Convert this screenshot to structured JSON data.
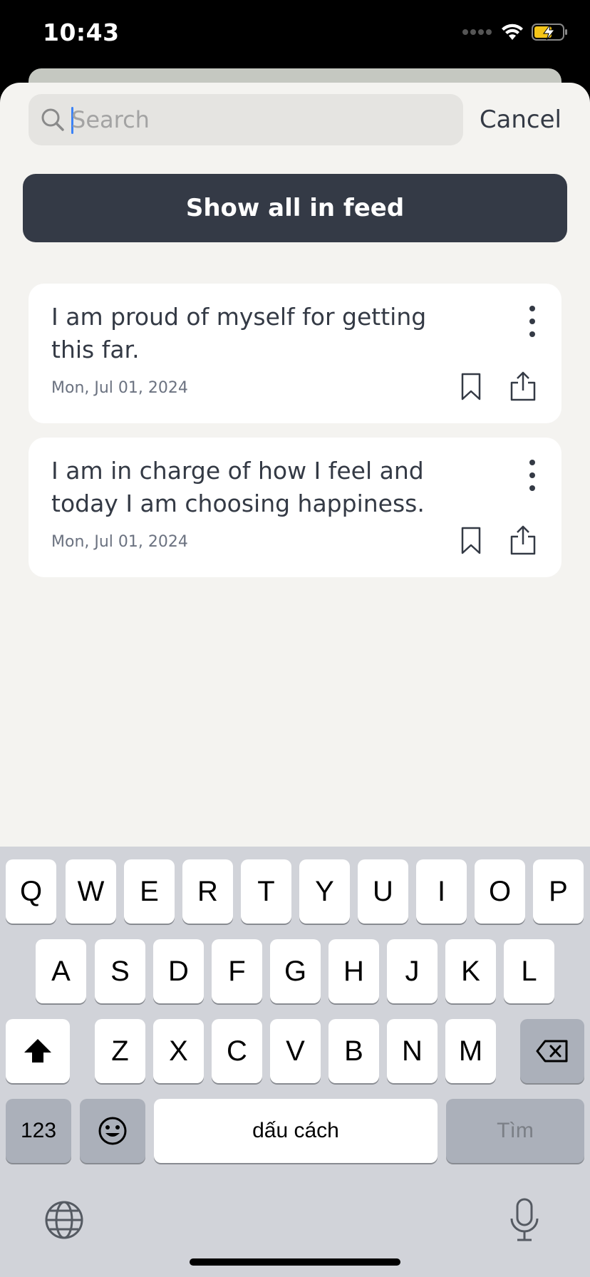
{
  "status_bar": {
    "time": "10:43"
  },
  "search": {
    "placeholder": "Search",
    "value": "",
    "cancel_label": "Cancel"
  },
  "show_all_label": "Show all in feed",
  "cards": [
    {
      "text": "I am proud of myself for getting this far.",
      "date": "Mon, Jul 01, 2024"
    },
    {
      "text": "I am in charge of how I feel and today I am choosing happiness.",
      "date": "Mon, Jul 01, 2024"
    }
  ],
  "keyboard": {
    "row1": [
      "Q",
      "W",
      "E",
      "R",
      "T",
      "Y",
      "U",
      "I",
      "O",
      "P"
    ],
    "row2": [
      "A",
      "S",
      "D",
      "F",
      "G",
      "H",
      "J",
      "K",
      "L"
    ],
    "row3": [
      "Z",
      "X",
      "C",
      "V",
      "B",
      "N",
      "M"
    ],
    "numbers_label": "123",
    "space_label": "dấu cách",
    "go_label": "Tìm"
  },
  "colors": {
    "primary_button": "#343a46",
    "sheet_background": "#f4f3f0",
    "text": "#343a45",
    "keyboard_background": "#d1d3d9"
  },
  "icons": [
    "search-icon",
    "more-vertical-icon",
    "bookmark-icon",
    "share-icon",
    "shift-icon",
    "backspace-icon",
    "emoji-icon",
    "globe-icon",
    "microphone-icon",
    "wifi-icon",
    "battery-charging-icon",
    "cellular-signal-icon"
  ]
}
